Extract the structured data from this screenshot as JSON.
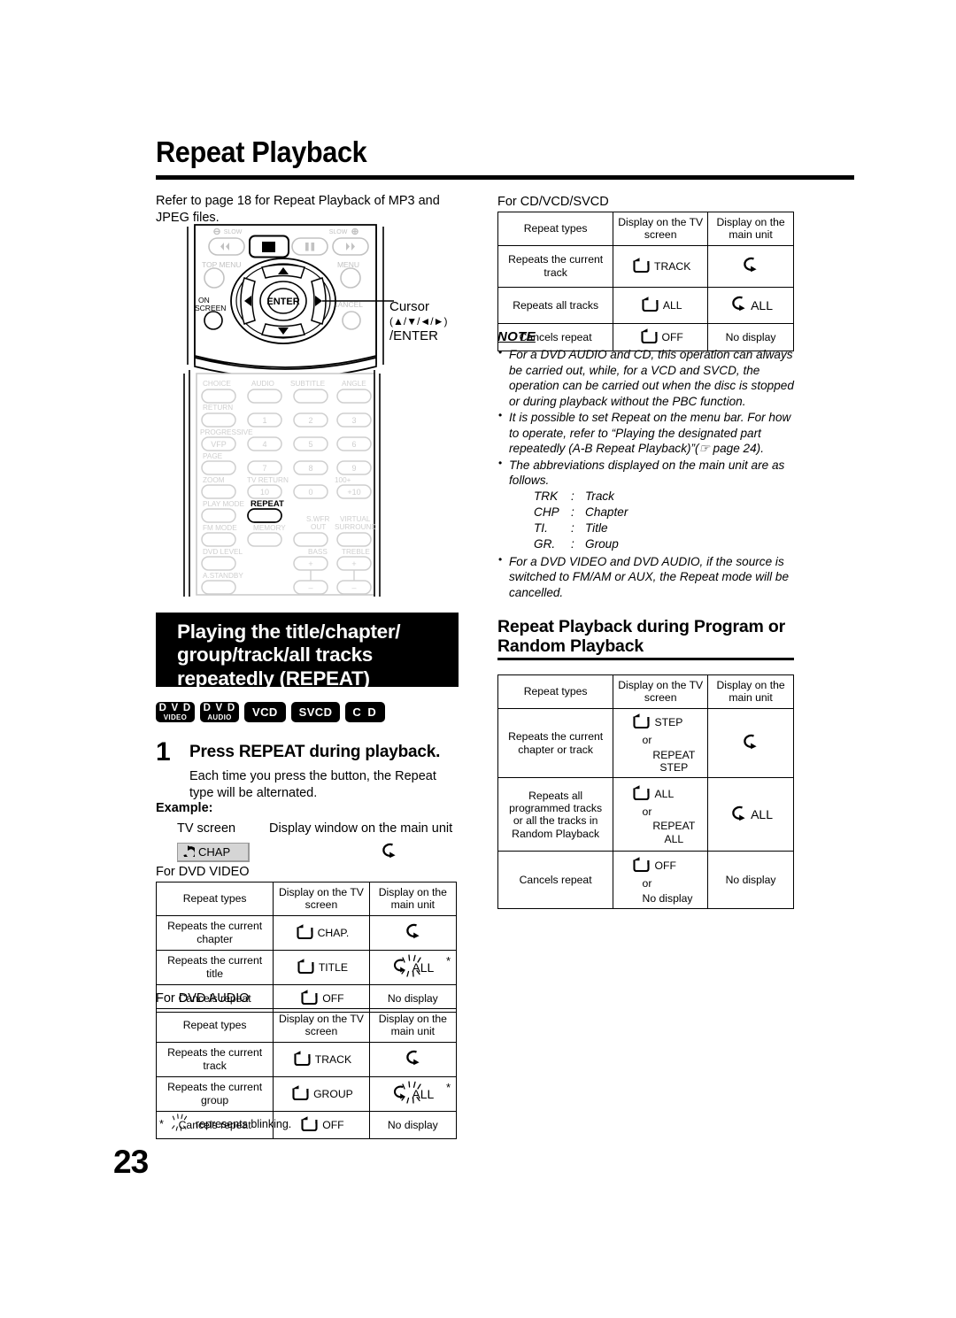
{
  "page": {
    "title": "Repeat Playback",
    "number": "23"
  },
  "left": {
    "intro": "Refer to page 18 for Repeat Playback of MP3 and JPEG files.",
    "callout": {
      "line1": "Cursor",
      "line2": "(▲/▼/◄/►)",
      "line3": "/ENTER"
    },
    "remote_labels": {
      "slow_left": "SLOW",
      "slow_right": "SLOW",
      "top_menu": "TOP MENU",
      "menu": "MENU",
      "on_screen_1": "ON",
      "on_screen_2": "SCREEN",
      "cancel": "CANCEL",
      "enter": "ENTER",
      "choice": "CHOICE",
      "audio": "AUDIO",
      "subtitle": "SUBTITLE",
      "angle": "ANGLE",
      "return": "RETURN",
      "progressive": "PROGRESSIVE",
      "vfp": "VFP",
      "page": "PAGE",
      "zoom": "ZOOM",
      "tv_return": "TV RETURN",
      "hundred_plus": "100+",
      "play_mode": "PLAY MODE",
      "repeat": "REPEAT",
      "fm_mode": "FM MODE",
      "memory": "MEMORY",
      "swfr_out_1": "S.WFR",
      "swfr_out_2": "OUT",
      "virtual_surround_1": "VIRTUAL",
      "virtual_surround_2": "SURROUND",
      "dvd_level": "DVD LEVEL",
      "bass": "BASS",
      "treble": "TREBLE",
      "a_standby": "A.STANDBY",
      "num_1": "1",
      "num_2": "2",
      "num_3": "3",
      "num_4": "4",
      "num_5": "5",
      "num_6": "6",
      "num_7": "7",
      "num_8": "8",
      "num_9": "9",
      "num_10": "10",
      "num_0": "0",
      "num_plus10": "+10",
      "plus": "+",
      "minus": "−"
    },
    "banner": {
      "line1": "Playing the title/chapter/",
      "line2": "group/track/all tracks",
      "line3": "repeatedly (REPEAT)"
    },
    "badges": [
      {
        "type": "two",
        "l1": "D V D",
        "l2": "VIDEO",
        "name": "badge-dvd-video"
      },
      {
        "type": "two",
        "l1": "D V D",
        "l2": "AUDIO",
        "name": "badge-dvd-audio"
      },
      {
        "type": "one",
        "l1": "VCD",
        "name": "badge-vcd"
      },
      {
        "type": "one",
        "l1": "SVCD",
        "name": "badge-svcd"
      },
      {
        "type": "cd",
        "l1": "C D",
        "name": "badge-cd"
      }
    ],
    "step": {
      "number": "1",
      "title": "Press REPEAT during playback.",
      "description": "Each time you press the button, the Repeat type will be alternated."
    },
    "example": {
      "label": "Example:",
      "tv_screen": "TV screen",
      "display_window": "Display window on the main unit",
      "chip_text": "CHAP"
    },
    "footnote": {
      "star": "*",
      "text": "represents blinking."
    }
  },
  "right": {
    "note": {
      "label": "NOTE",
      "items": [
        "For a DVD AUDIO and CD, this operation can always be carried out, while, for a VCD and SVCD, the operation can be carried out when the disc is stopped or during playback without the PBC function.",
        "It is possible to set Repeat on the menu bar. For how to operate, refer to “Playing the designated part repeatedly (A-B Repeat Playback)”(☞ page 24).",
        "The abbreviations displayed on the main unit are as follows.",
        "For a DVD VIDEO and DVD AUDIO, if the source is switched to FM/AM or AUX, the Repeat mode will be cancelled."
      ],
      "abbreviations": [
        {
          "key": "TRK",
          "colon": ":",
          "value": "Track"
        },
        {
          "key": "CHP",
          "colon": ":",
          "value": "Chapter"
        },
        {
          "key": "TI.",
          "colon": ":",
          "value": "Title"
        },
        {
          "key": "GR.",
          "colon": ":",
          "value": "Group"
        }
      ]
    },
    "subheading": {
      "line1": "Repeat Playback during Program or",
      "line2": "Random Playback"
    }
  },
  "tables": {
    "headers": {
      "col1": "Repeat types",
      "col2_l1": "Display on the TV",
      "col2_l2": "screen",
      "col3_l1": "Display on the",
      "col3_l2": "main unit"
    },
    "cd_vcd_svcd": {
      "caption": "For CD/VCD/SVCD",
      "rows": [
        {
          "type_l1": "Repeats the current",
          "type_l2": "track",
          "tv": "TRACK",
          "tv_icon": "repeat-loop-icon",
          "unit": "",
          "unit_icon": "curved-arrow-icon"
        },
        {
          "type_l1": "Repeats all tracks",
          "type_l2": "",
          "tv": "ALL",
          "tv_icon": "repeat-loop-icon",
          "unit": "ALL",
          "unit_icon": "curved-arrow-icon"
        },
        {
          "type_l1": "Cancels repeat",
          "type_l2": "",
          "tv": "OFF",
          "tv_icon": "repeat-loop-icon",
          "unit": "No display",
          "unit_icon": ""
        }
      ]
    },
    "program_random": {
      "rows": [
        {
          "type_l1": "Repeats the current",
          "type_l2": "chapter or track",
          "tv_lines": [
            "STEP",
            "or",
            "REPEAT STEP"
          ],
          "unit": "",
          "unit_icon": "curved-arrow-icon"
        },
        {
          "type_l1": "Repeats all",
          "type_l2": "programmed tracks",
          "type_l3": "or all the tracks in",
          "type_l4": "Random Playback",
          "tv_lines": [
            "ALL",
            "or",
            "REPEAT ALL"
          ],
          "unit": "ALL",
          "unit_icon": "curved-arrow-icon"
        },
        {
          "type_l1": "Cancels repeat",
          "type_l2": "",
          "tv_lines": [
            "OFF",
            "or",
            "No display"
          ],
          "unit": "No display",
          "unit_icon": ""
        }
      ]
    },
    "dvd_video": {
      "caption": "For DVD VIDEO",
      "rows": [
        {
          "type_l1": "Repeats the current",
          "type_l2": "chapter",
          "tv": "CHAP.",
          "tv_icon": "repeat-loop-icon",
          "unit": "",
          "unit_icon": "curved-arrow-icon"
        },
        {
          "type_l1": "Repeats the current",
          "type_l2": "title",
          "tv": "TITLE",
          "tv_icon": "repeat-loop-icon",
          "unit": "ALL",
          "unit_icon": "curved-arrow-blinking-icon",
          "star": "*"
        },
        {
          "type_l1": "Cancels repeat",
          "type_l2": "",
          "tv": "OFF",
          "tv_icon": "repeat-loop-icon",
          "unit": "No display",
          "unit_icon": ""
        }
      ]
    },
    "dvd_audio": {
      "caption": "For DVD AUDIO",
      "rows": [
        {
          "type_l1": "Repeats the current",
          "type_l2": "track",
          "tv": "TRACK",
          "tv_icon": "repeat-loop-icon",
          "unit": "",
          "unit_icon": "curved-arrow-icon"
        },
        {
          "type_l1": "Repeats the current",
          "type_l2": "group",
          "tv": "GROUP",
          "tv_icon": "repeat-loop-icon",
          "unit": "ALL",
          "unit_icon": "curved-arrow-blinking-icon",
          "star": "*"
        },
        {
          "type_l1": "Cancels repeat",
          "type_l2": "",
          "tv": "OFF",
          "tv_icon": "repeat-loop-icon",
          "unit": "No display",
          "unit_icon": ""
        }
      ]
    }
  },
  "colors": {
    "ink": "#000000",
    "paper": "#ffffff",
    "chip_fill": "#d5d5d5",
    "remote_line": "#000000",
    "remote_faint": "#c9c9c9"
  }
}
